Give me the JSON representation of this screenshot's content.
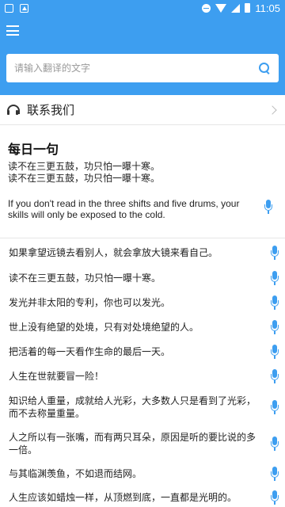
{
  "status_bar": {
    "time": "11:05"
  },
  "search": {
    "placeholder": "请输入翻译的文字"
  },
  "contact": {
    "label": "联系我们"
  },
  "daily": {
    "title": "每日一句",
    "zh_lines": [
      "读不在三更五鼓，功只怕一曝十寒。",
      "读不在三更五鼓，功只怕一曝十寒。"
    ],
    "en": "If you don't read in the three shifts and five drums, your skills will only be exposed to the cold."
  },
  "quotes": [
    "如果拿望远镜去看别人，就会拿放大镜来看自己。",
    "读不在三更五鼓，功只怕一曝十寒。",
    "发光并非太阳的专利，你也可以发光。",
    "世上没有绝望的处境，只有对处境绝望的人。",
    "把活着的每一天看作生命的最后一天。",
    "人生在世就要冒一险！",
    "知识给人重量，成就给人光彩，大多数人只是看到了光彩，而不去称量重量。",
    "人之所以有一张嘴，而有两只耳朵，原因是听的要比说的多一倍。",
    "与其临渊羡鱼，不如退而结网。",
    "人生应该如蜡烛一样，从顶燃到底，一直都是光明的。"
  ],
  "colors": {
    "primary": "#3d9ef0"
  },
  "icons": [
    "menu-icon",
    "search-icon",
    "headset-icon",
    "chevron-right-icon",
    "microphone-icon"
  ]
}
